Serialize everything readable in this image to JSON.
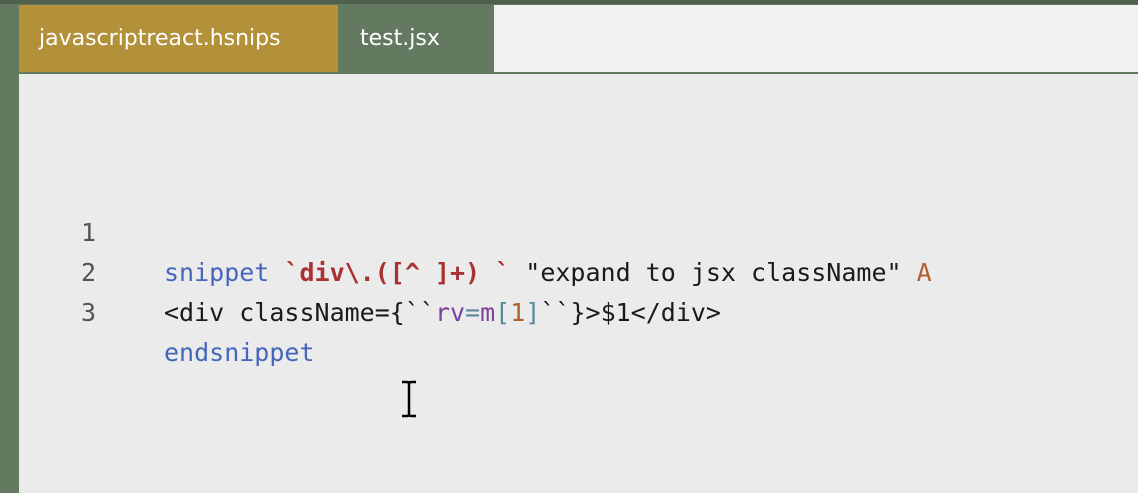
{
  "tabs": [
    {
      "label": "javascriptreact.hsnips",
      "active": true
    },
    {
      "label": "test.jsx",
      "active": false
    }
  ],
  "editor": {
    "lines": [
      {
        "number": "1",
        "tokens": {
          "kw": "snippet",
          "sp1": " ",
          "re": "`div\\.([^ ]+) `",
          "sp2": " ",
          "str": "\"expand to jsx className\"",
          "sp3": " ",
          "opt": "A"
        }
      },
      {
        "number": "2",
        "tokens": {
          "pre": "<div className={``",
          "var1": "rv",
          "op": "=",
          "var2": "m",
          "br1": "[",
          "num": "1",
          "br2": "]",
          "post": "``}>$1</div>"
        }
      },
      {
        "number": "3",
        "tokens": {
          "kw": "endsnippet"
        }
      }
    ]
  },
  "colors": {
    "frame": "#637a60",
    "active_tab": "#b3913a",
    "editor_bg": "#ebebeb",
    "keyword": "#4466bb",
    "regex": "#a83232"
  },
  "icons": {
    "cursor": "text-cursor-icon"
  }
}
